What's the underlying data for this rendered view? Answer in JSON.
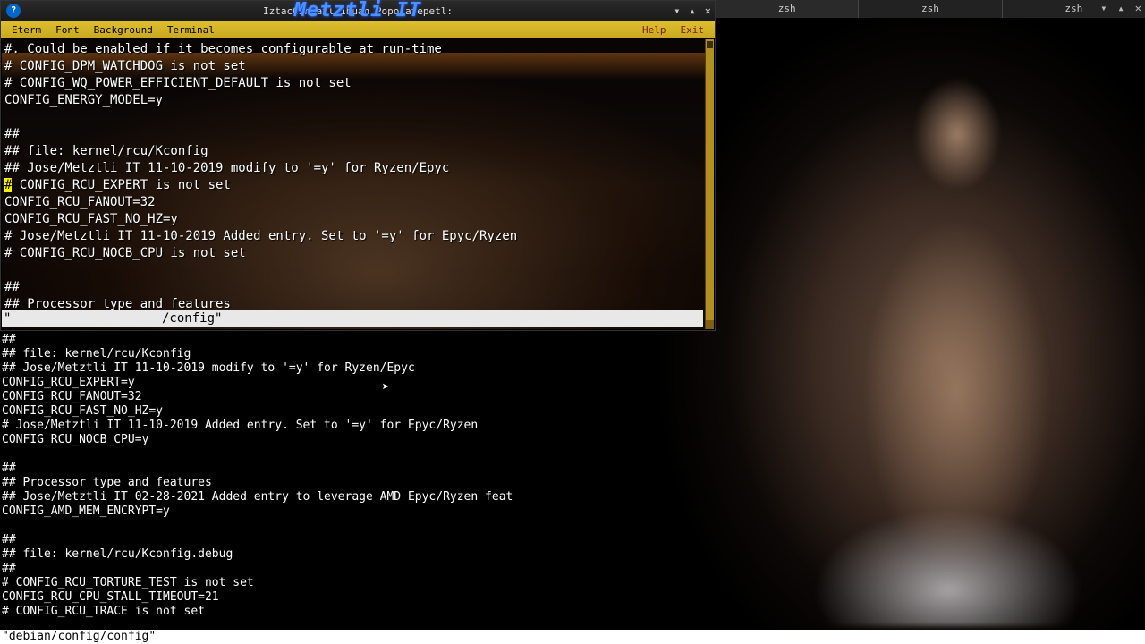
{
  "desktop": {
    "panel_tabs": [
      "zsh",
      "zsh",
      "zsh"
    ]
  },
  "screen_controls": {
    "min": "▾",
    "max": "▴",
    "close": "✕"
  },
  "eterm": {
    "titlebar": {
      "app_icon_char": "?",
      "title": "IztacCihuatl ihuan Popocatepetl:",
      "watermark": "Metztli IT",
      "min": "▾",
      "up": "▴",
      "close": "✕"
    },
    "menubar": {
      "items": [
        "Eterm",
        "Font",
        "Background",
        "Terminal"
      ],
      "right": [
        "Help",
        "Exit"
      ]
    },
    "lines": [
      "#. Could be enabled if it becomes configurable at run-time",
      "# CONFIG_DPM_WATCHDOG is not set",
      "# CONFIG_WQ_POWER_EFFICIENT_DEFAULT is not set",
      "CONFIG_ENERGY_MODEL=y",
      "",
      "##",
      "## file: kernel/rcu/Kconfig",
      "## Jose/Metztli IT 11-10-2019 modify to '=y' for Ryzen/Epyc",
      "# CONFIG_RCU_EXPERT is not set",
      "CONFIG_RCU_FANOUT=32",
      "CONFIG_RCU_FAST_NO_HZ=y",
      "# Jose/Metztli IT 11-10-2019 Added entry. Set to '=y' for Epyc/Ryzen",
      "# CONFIG_RCU_NOCB_CPU is not set",
      "",
      "##",
      "## Processor type and features"
    ],
    "highlight_line_index": 8,
    "status_line": "\"                    /config\""
  },
  "bg_terminal": {
    "lines": [
      "##",
      "## file: kernel/rcu/Kconfig",
      "## Jose/Metztli IT 11-10-2019 modify to '=y' for Ryzen/Epyc",
      "CONFIG_RCU_EXPERT=y",
      "CONFIG_RCU_FANOUT=32",
      "CONFIG_RCU_FAST_NO_HZ=y",
      "# Jose/Metztli IT 11-10-2019 Added entry. Set to '=y' for Epyc/Ryzen",
      "CONFIG_RCU_NOCB_CPU=y",
      "",
      "##",
      "## Processor type and features",
      "## Jose/Metztli IT 02-28-2021 Added entry to leverage AMD Epyc/Ryzen feat",
      "CONFIG_AMD_MEM_ENCRYPT=y",
      "",
      "##",
      "## file: kernel/rcu/Kconfig.debug",
      "##",
      "# CONFIG_RCU_TORTURE_TEST is not set",
      "CONFIG_RCU_CPU_STALL_TIMEOUT=21",
      "# CONFIG_RCU_TRACE is not set"
    ],
    "status_line": "\"debian/config/config\""
  }
}
